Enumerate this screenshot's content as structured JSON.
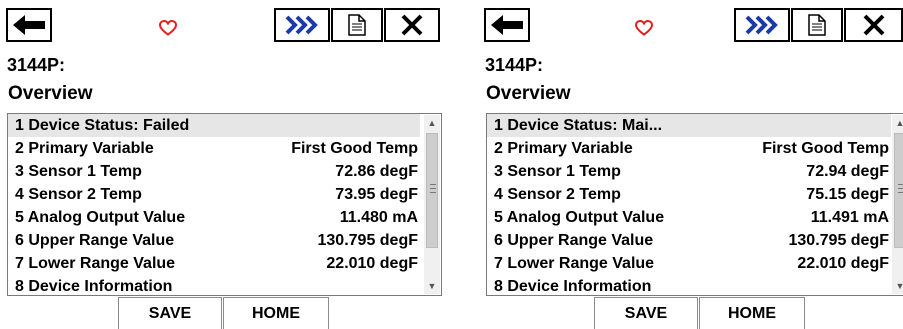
{
  "colors": {
    "favorite_heart": "#e02020",
    "hotkey_icon": "#1a3aa8",
    "selected_row": "#e6e6e6"
  },
  "icons": {
    "back": "left-arrow-icon",
    "favorite": "heart-icon",
    "hotkey": "fast-forward-icon",
    "document": "document-icon",
    "close": "close-icon"
  },
  "panels": [
    {
      "device_tag": "3144P:",
      "menu_title": "Overview",
      "items": [
        {
          "label": "1 Device Status: Failed",
          "value": "",
          "selected": true
        },
        {
          "label": "2 Primary Variable",
          "value": "First Good Temp"
        },
        {
          "label": "3 Sensor 1 Temp",
          "value": "72.86 degF"
        },
        {
          "label": "4 Sensor 2 Temp",
          "value": "73.95 degF"
        },
        {
          "label": "5 Analog Output Value",
          "value": "11.480 mA"
        },
        {
          "label": "6 Upper Range Value",
          "value": "130.795 degF"
        },
        {
          "label": "7 Lower Range Value",
          "value": "22.010 degF"
        },
        {
          "label": "8 Device Information",
          "value": ""
        }
      ],
      "footer": {
        "save": "SAVE",
        "home": "HOME"
      }
    },
    {
      "device_tag": "3144P:",
      "menu_title": "Overview",
      "items": [
        {
          "label": "1 Device Status: Mai...",
          "value": "",
          "selected": true
        },
        {
          "label": "2 Primary Variable",
          "value": "First Good Temp"
        },
        {
          "label": "3 Sensor 1 Temp",
          "value": "72.94 degF"
        },
        {
          "label": "4 Sensor 2 Temp",
          "value": "75.15 degF"
        },
        {
          "label": "5 Analog Output Value",
          "value": "11.491 mA"
        },
        {
          "label": "6 Upper Range Value",
          "value": "130.795 degF"
        },
        {
          "label": "7 Lower Range Value",
          "value": "22.010 degF"
        },
        {
          "label": "8 Device Information",
          "value": ""
        }
      ],
      "footer": {
        "save": "SAVE",
        "home": "HOME"
      }
    }
  ]
}
